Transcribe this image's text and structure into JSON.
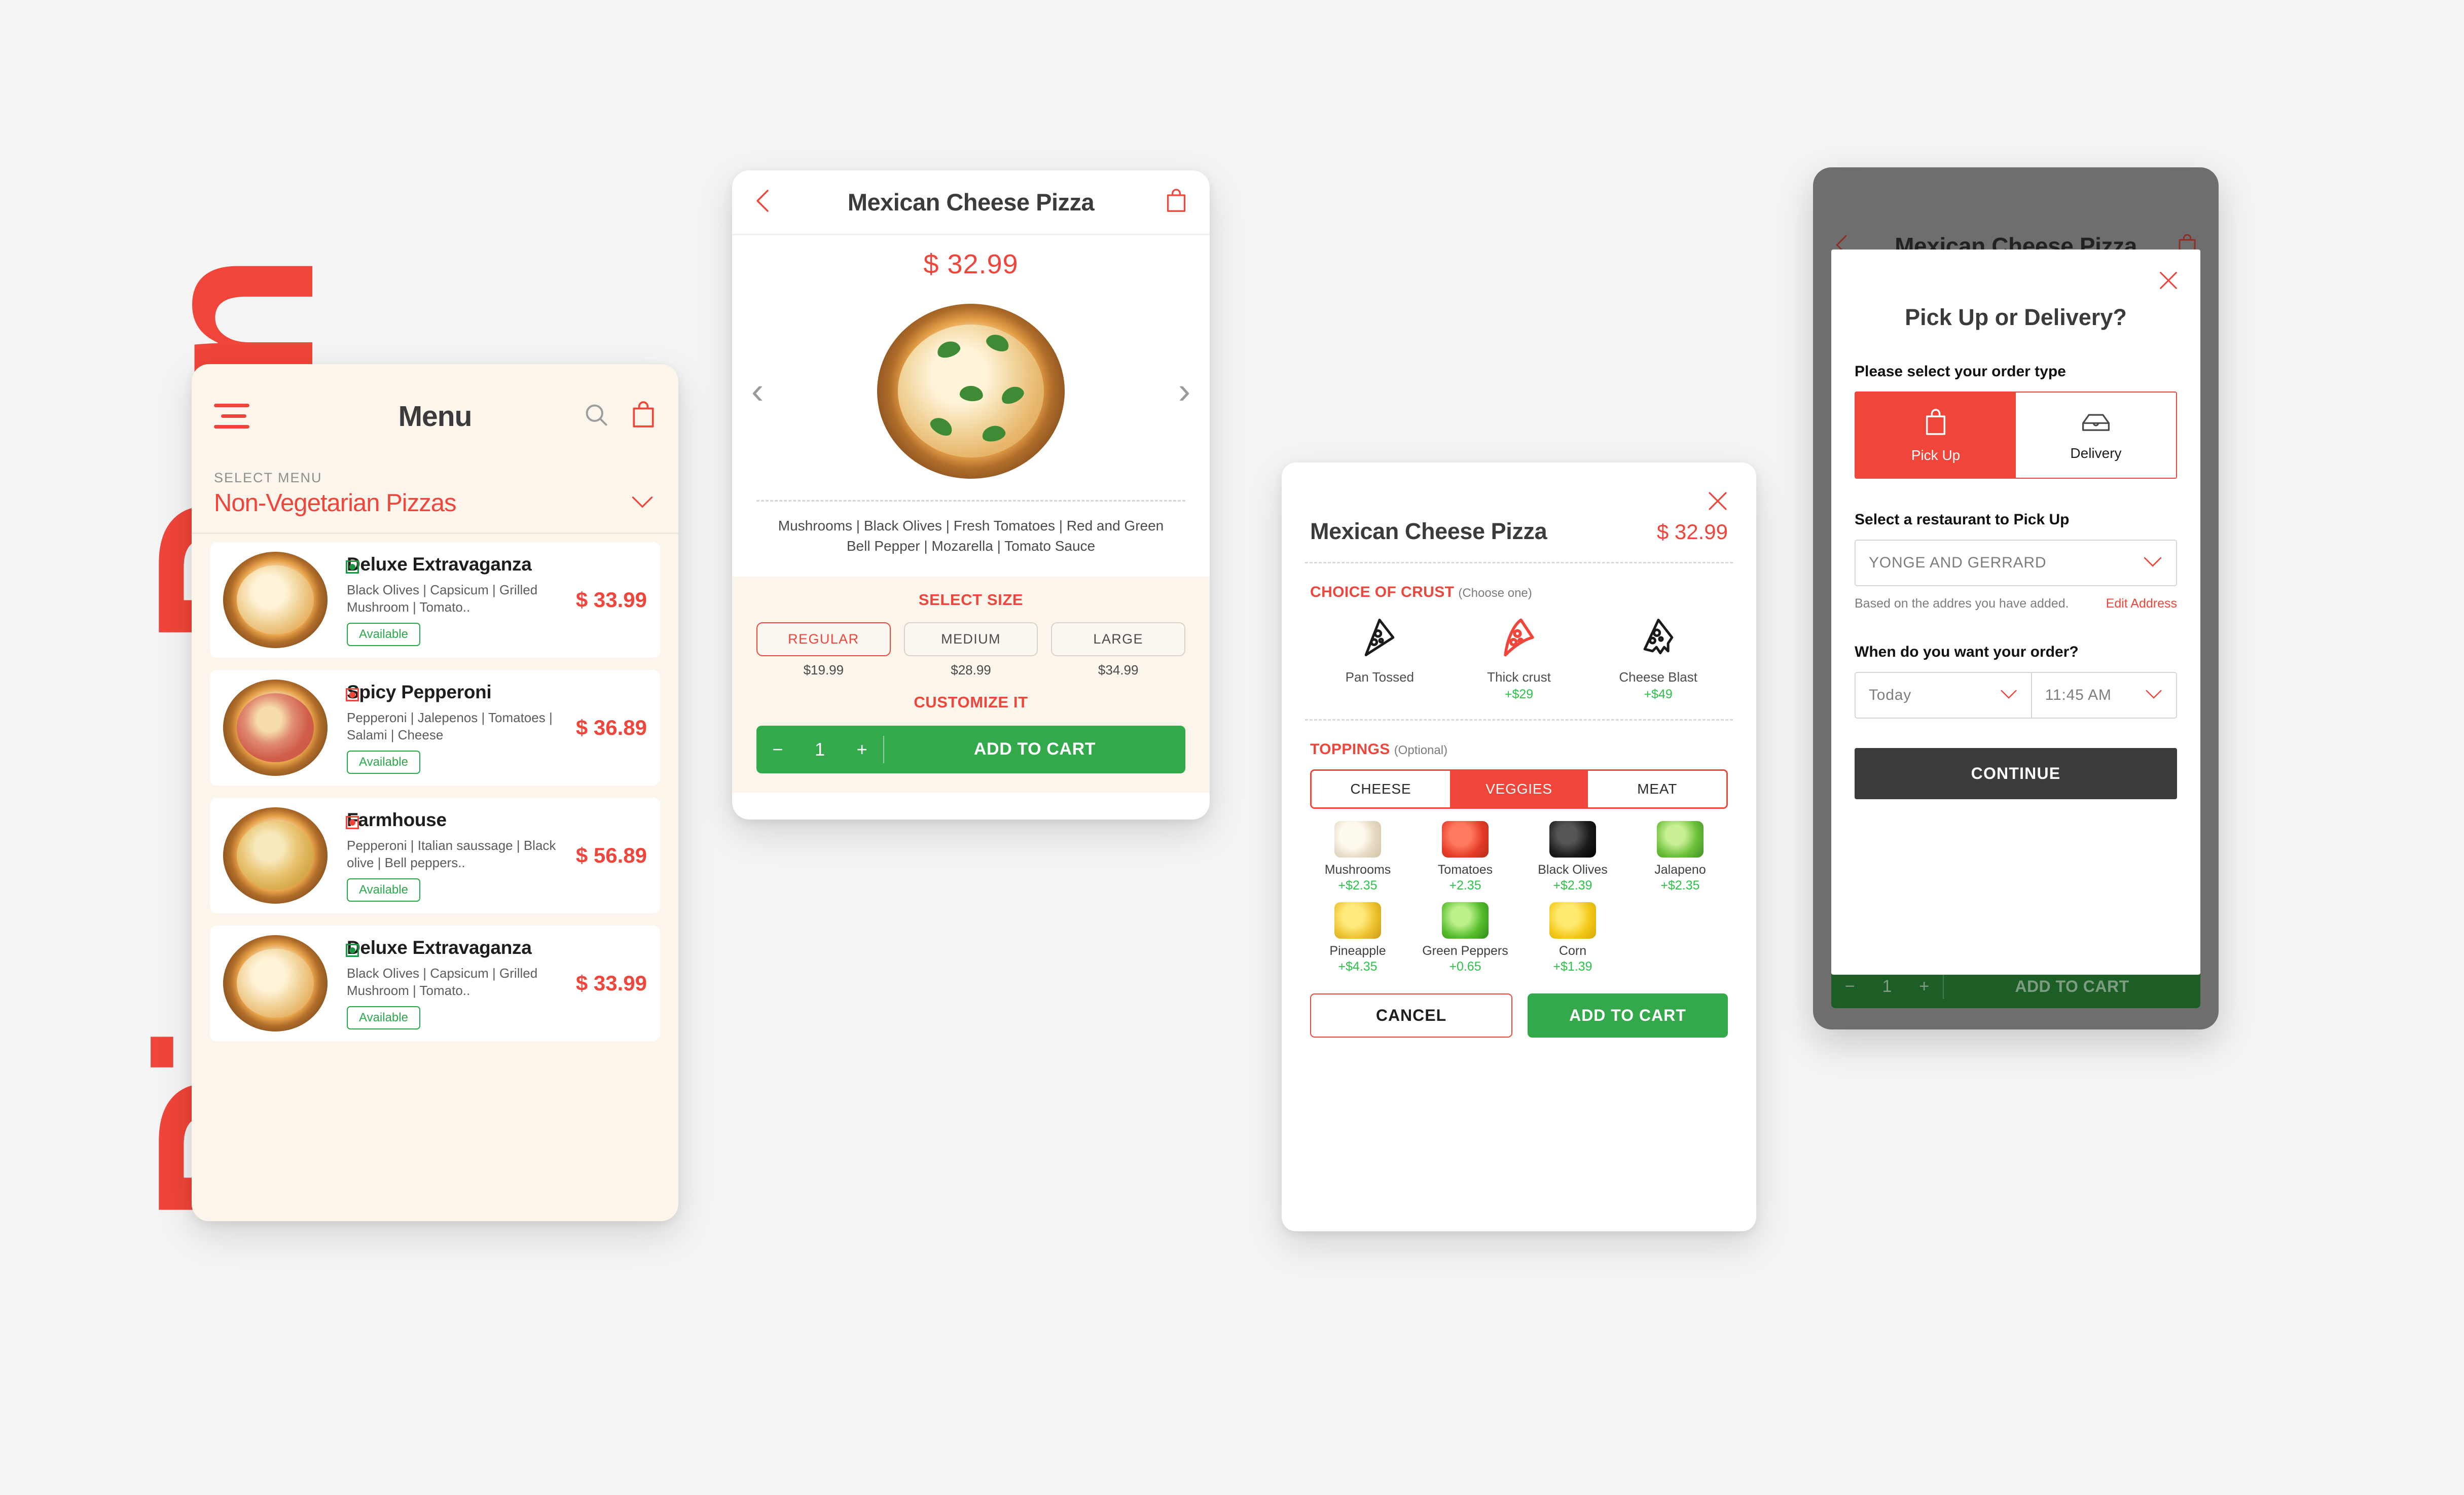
{
  "brand": {
    "wordmark": "Pizza Pan",
    "accent": "#f0453a",
    "green": "#33a94c",
    "cream": "#fbf5ec"
  },
  "menu_screen": {
    "title": "Menu",
    "select_menu_label": "SELECT MENU",
    "selected_menu": "Non-Vegetarian Pizzas",
    "items": [
      {
        "name": "Deluxe Extravaganza",
        "desc": "Black Olives | Capsicum | Grilled Mushroom | Tomato..",
        "status": "Available",
        "price": "$ 33.99",
        "diet": "veg"
      },
      {
        "name": "Spicy Pepperoni",
        "desc": "Pepperoni | Jalepenos | Tomatoes | Salami | Cheese",
        "status": "Available",
        "price": "$ 36.89",
        "diet": "nonveg"
      },
      {
        "name": "Farmhouse",
        "desc": "Pepperoni | Italian saussage | Black olive | Bell peppers..",
        "status": "Available",
        "price": "$ 56.89",
        "diet": "nonveg"
      },
      {
        "name": "Deluxe Extravaganza",
        "desc": "Black Olives | Capsicum | Grilled Mushroom | Tomato..",
        "status": "Available",
        "price": "$ 33.99",
        "diet": "veg"
      }
    ]
  },
  "detail_screen": {
    "title": "Mexican Cheese Pizza",
    "price": "$ 32.99",
    "description": "Mushrooms | Black Olives | Fresh Tomatoes | Red and Green Bell Pepper | Mozarella | Tomato Sauce",
    "select_size_label": "SELECT SIZE",
    "sizes": [
      {
        "label": "REGULAR",
        "price": "$19.99",
        "selected": true
      },
      {
        "label": "MEDIUM",
        "price": "$28.99",
        "selected": false
      },
      {
        "label": "LARGE",
        "price": "$34.99",
        "selected": false
      }
    ],
    "customize_label": "CUSTOMIZE IT",
    "quantity": "1",
    "add_to_cart_label": "ADD TO CART",
    "minus": "−",
    "plus": "+"
  },
  "customize_modal": {
    "title": "Mexican Cheese Pizza",
    "price": "$ 32.99",
    "crust_heading": "CHOICE OF CRUST",
    "crust_hint": "(Choose one)",
    "crusts": [
      {
        "name": "Pan Tossed",
        "add": "",
        "selected": false
      },
      {
        "name": "Thick crust",
        "add": "+$29",
        "selected": true
      },
      {
        "name": "Cheese Blast",
        "add": "+$49",
        "selected": false
      }
    ],
    "toppings_heading": "TOPPINGS",
    "toppings_hint": "(Optional)",
    "tabs": [
      {
        "label": "CHEESE",
        "active": false
      },
      {
        "label": "VEGGIES",
        "active": true
      },
      {
        "label": "MEAT",
        "active": false
      }
    ],
    "toppings": [
      {
        "name": "Mushrooms",
        "add": "+$2.35"
      },
      {
        "name": "Tomatoes",
        "add": "+2.35"
      },
      {
        "name": "Black Olives",
        "add": "+$2.39"
      },
      {
        "name": "Jalapeno",
        "add": "+$2.35"
      },
      {
        "name": "Pineapple",
        "add": "+$4.35"
      },
      {
        "name": "Green Peppers",
        "add": "+0.65"
      },
      {
        "name": "Corn",
        "add": "+$1.39"
      }
    ],
    "cancel_label": "CANCEL",
    "add_to_cart_label": "ADD TO CART"
  },
  "order_type_screen": {
    "tablet_title": "Mexican Cheese Pizza",
    "bottom_quantity": "1",
    "bottom_add_to_cart": "ADD TO CART",
    "modal_title": "Pick Up or Delivery?",
    "order_type_label": "Please select your order type",
    "options": [
      {
        "label": "Pick Up",
        "active": true
      },
      {
        "label": "Delivery",
        "active": false
      }
    ],
    "restaurant_label": "Select a restaurant to Pick Up",
    "restaurant_value": "YONGE AND GERRARD",
    "address_note": "Based on the addres you have added.",
    "edit_address_label": "Edit Address",
    "when_label": "When do you want your order?",
    "day_value": "Today",
    "time_value": "11:45 AM",
    "continue_label": "CONTINUE"
  }
}
